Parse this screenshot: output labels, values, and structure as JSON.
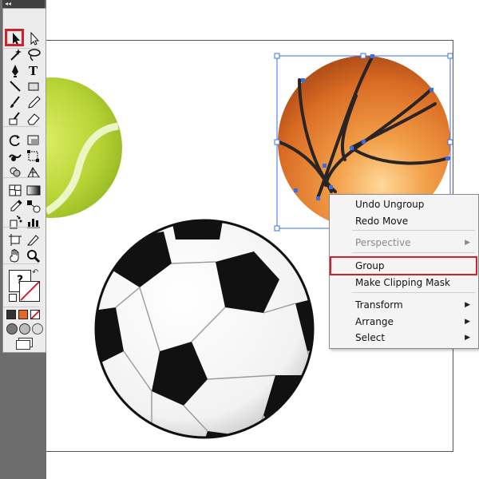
{
  "toolbar": {
    "collapse_glyph": "◂◂",
    "tools": [
      {
        "name": "selection-tool-icon"
      },
      {
        "name": "direct-selection-tool-icon"
      },
      {
        "name": "magic-wand-tool-icon"
      },
      {
        "name": "lasso-tool-icon"
      },
      {
        "name": "pen-tool-icon"
      },
      {
        "name": "type-tool-icon"
      },
      {
        "name": "line-segment-tool-icon"
      },
      {
        "name": "rectangle-tool-icon"
      },
      {
        "name": "paintbrush-tool-icon"
      },
      {
        "name": "pencil-tool-icon"
      },
      {
        "name": "blob-brush-tool-icon"
      },
      {
        "name": "eraser-tool-icon"
      },
      {
        "name": "rotate-tool-icon"
      },
      {
        "name": "scale-tool-icon"
      },
      {
        "name": "warp-tool-icon"
      },
      {
        "name": "free-transform-tool-icon"
      },
      {
        "name": "shape-builder-tool-icon"
      },
      {
        "name": "perspective-grid-tool-icon"
      },
      {
        "name": "mesh-tool-icon"
      },
      {
        "name": "gradient-tool-icon"
      },
      {
        "name": "eyedropper-tool-icon"
      },
      {
        "name": "blend-tool-icon"
      },
      {
        "name": "symbol-sprayer-tool-icon"
      },
      {
        "name": "column-graph-tool-icon"
      },
      {
        "name": "artboard-tool-icon"
      },
      {
        "name": "slice-tool-icon"
      },
      {
        "name": "hand-tool-icon"
      },
      {
        "name": "zoom-tool-icon"
      }
    ],
    "fill_label": "?"
  },
  "context_menu": {
    "items": [
      {
        "label": "Undo Ungroup",
        "enabled": true,
        "submenu": false
      },
      {
        "label": "Redo Move",
        "enabled": true,
        "submenu": false
      },
      {
        "label": "Perspective",
        "enabled": false,
        "submenu": true
      },
      {
        "label": "Group",
        "enabled": true,
        "submenu": false
      },
      {
        "label": "Make Clipping Mask",
        "enabled": true,
        "submenu": false
      },
      {
        "label": "Transform",
        "enabled": true,
        "submenu": true
      },
      {
        "label": "Arrange",
        "enabled": true,
        "submenu": true
      },
      {
        "label": "Select",
        "enabled": true,
        "submenu": true
      }
    ],
    "submenu_arrow": "▶"
  },
  "colors": {
    "highlight": "#d0202a",
    "selection_blue": "#3a6ee8",
    "basketball": "#e0762a",
    "tennis_ball": "#b5d22f"
  }
}
